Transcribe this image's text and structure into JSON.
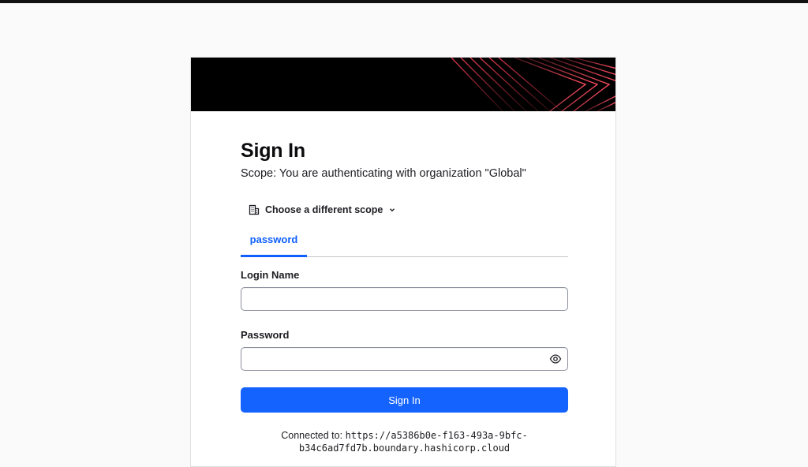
{
  "page": {
    "title": "Sign In",
    "scope_text": "Scope: You are authenticating with organization \"Global\"",
    "scope_button_label": "Choose a different scope",
    "tabs": [
      {
        "label": "password",
        "active": true
      }
    ],
    "login_name": {
      "label": "Login Name",
      "value": "",
      "placeholder": ""
    },
    "password": {
      "label": "Password",
      "value": "",
      "placeholder": ""
    },
    "submit_label": "Sign In",
    "connected_label": "Connected to:",
    "connected_url_part1": "https://a5386b0e-f163-493a-9bfc-",
    "connected_url_part2": "b34c6ad7fd7b.boundary.hashicorp.cloud"
  },
  "colors": {
    "accent": "#1563ff",
    "banner": "#000000",
    "banner_lines": "#e0394f"
  },
  "icons": [
    "building-icon",
    "chevron-down-icon",
    "eye-icon"
  ]
}
